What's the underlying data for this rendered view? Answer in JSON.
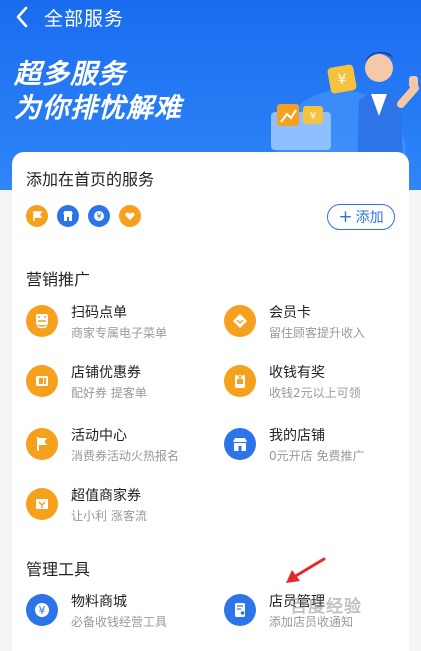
{
  "header": {
    "title": "全部服务",
    "back_icon": "chevron-left-icon"
  },
  "banner": {
    "line1": "超多服务",
    "line2": "为你排忧解难"
  },
  "favorites": {
    "title": "添加在首页的服务",
    "icons": [
      "flag-icon",
      "store-icon",
      "coin-icon",
      "heart-icon"
    ],
    "add_label": "添加"
  },
  "marketing": {
    "title": "营销推广",
    "items": [
      {
        "title": "扫码点单",
        "subtitle": "商家专属电子菜单",
        "icon": "scan-menu-icon"
      },
      {
        "title": "会员卡",
        "subtitle": "留住顾客提升收入",
        "icon": "member-card-icon"
      },
      {
        "title": "店铺优惠券",
        "subtitle": "配好券 提客单",
        "icon": "coupon-icon"
      },
      {
        "title": "收钱有奖",
        "subtitle": "收钱2元以上可领",
        "icon": "gift-icon"
      },
      {
        "title": "活动中心",
        "subtitle": "消费券活动火热报名",
        "icon": "flag-icon"
      },
      {
        "title": "我的店铺",
        "subtitle": "0元开店 免费推广",
        "icon": "store-icon"
      },
      {
        "title": "超值商家券",
        "subtitle": "让小利 涨客流",
        "icon": "merchant-coupon-icon"
      }
    ]
  },
  "tools": {
    "title": "管理工具",
    "items": [
      {
        "title": "物料商城",
        "subtitle": "必备收钱经营工具",
        "icon": "coin-icon"
      },
      {
        "title": "店员管理",
        "subtitle": "添加店员收通知",
        "icon": "staff-icon"
      }
    ]
  },
  "watermark": "百度经验",
  "colors": {
    "primary": "#2d74e8",
    "orange": "#f6a11d",
    "arrow": "#e52a2a"
  }
}
